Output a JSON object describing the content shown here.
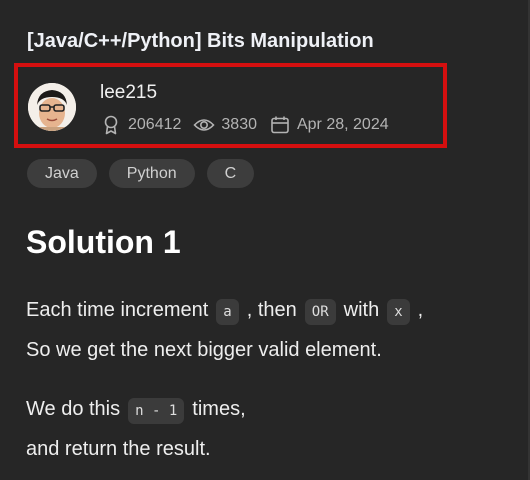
{
  "post": {
    "title": "[Java/C++/Python] Bits Manipulation"
  },
  "author": {
    "name": "lee215",
    "reputation": "206412",
    "views": "3830",
    "date": "Apr 28, 2024"
  },
  "tags": [
    "Java",
    "Python",
    "C"
  ],
  "content": {
    "heading": "Solution 1",
    "p1_line1_a": "Each time increment",
    "p1_code1": "a",
    "p1_line1_b": ", then",
    "p1_code2": "OR",
    "p1_line1_c": "with",
    "p1_code3": "x",
    "p1_line1_d": ",",
    "p1_line2": "So we get the next bigger valid element.",
    "p2_line1_a": "We do this",
    "p2_code1": "n - 1",
    "p2_line1_b": "times,",
    "p2_line2": "and return the result."
  },
  "icons": {
    "reputation": "badge-icon",
    "views": "eye-icon",
    "date": "calendar-icon"
  },
  "colors": {
    "background": "#262626",
    "highlight_border": "#d40f0f",
    "tag_background": "#3d3d3d",
    "code_background": "#3b3b3b"
  }
}
